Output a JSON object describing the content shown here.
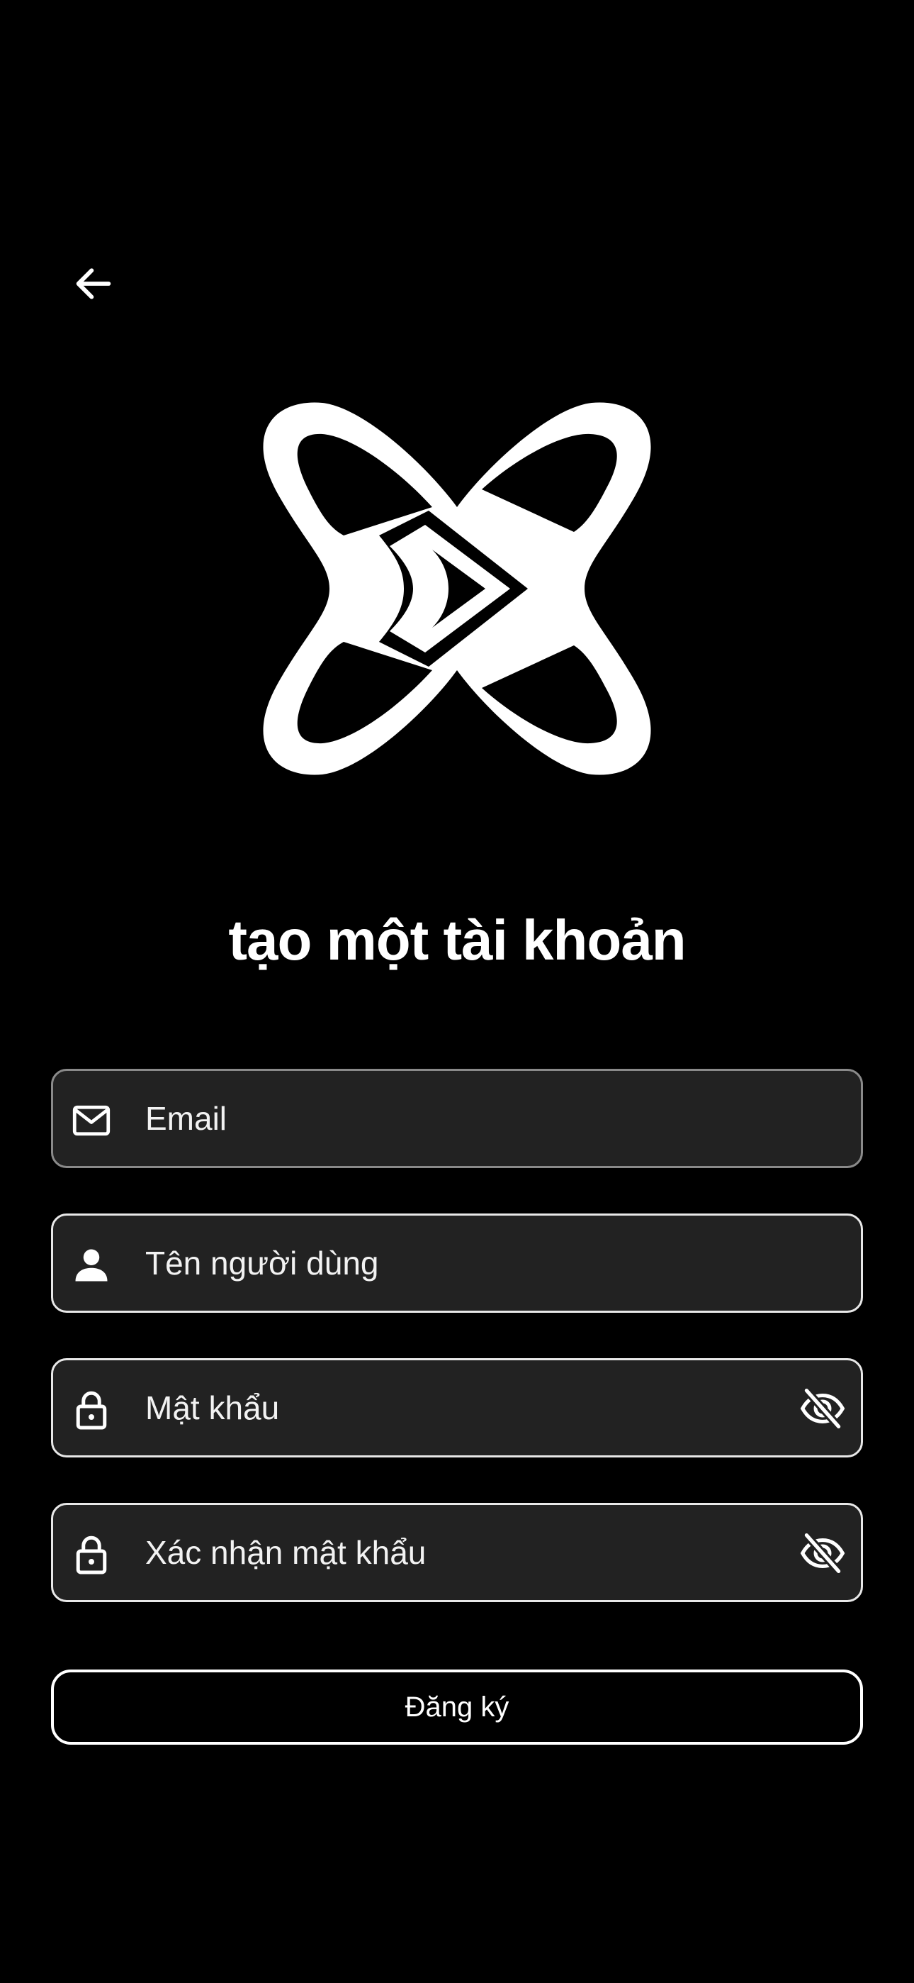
{
  "header": {
    "back_icon": "arrow-left-icon"
  },
  "logo": {
    "icon": "atom-x-logo",
    "color": "#ffffff"
  },
  "title": "tạo một tài khoản",
  "form": {
    "email": {
      "placeholder": "Email",
      "icon": "mail-icon"
    },
    "username": {
      "placeholder": "Tên người dùng",
      "icon": "person-icon"
    },
    "password": {
      "placeholder": "Mật khẩu",
      "icon": "lock-icon",
      "toggle_icon": "eye-off-icon"
    },
    "confirm_password": {
      "placeholder": "Xác nhận mật khẩu",
      "icon": "lock-icon",
      "toggle_icon": "eye-off-icon"
    },
    "submit_label": "Đăng ký"
  },
  "colors": {
    "background": "#000000",
    "field_background": "#222222",
    "text": "#ffffff"
  }
}
